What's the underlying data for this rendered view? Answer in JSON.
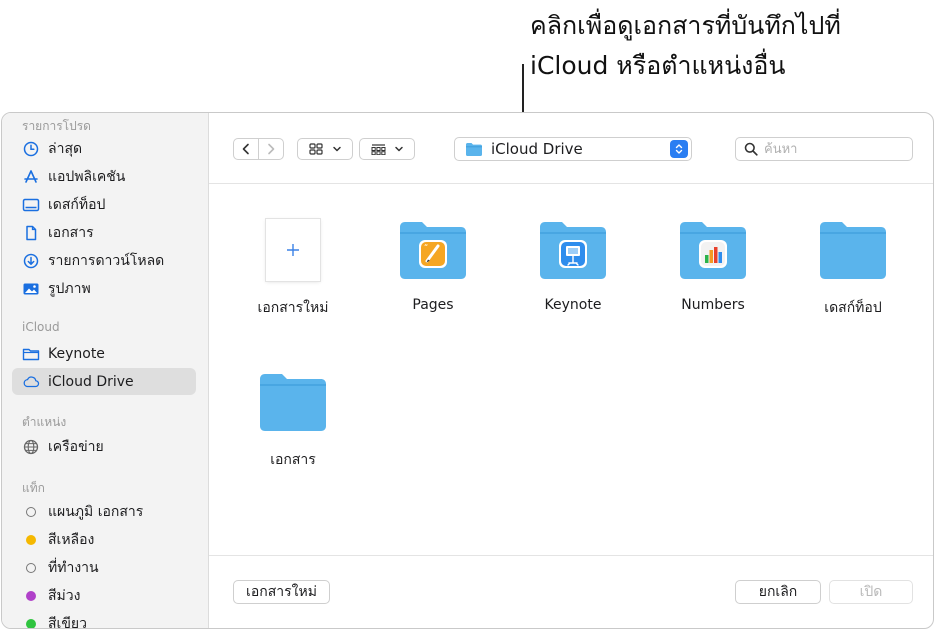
{
  "callout": {
    "line1": "คลิกเพื่อดูเอกสารที่บันทึกไปที่",
    "line2": "iCloud หรือตำแหน่งอื่น"
  },
  "sidebar": {
    "favorites_header": "รายการโปรด",
    "favorites": [
      {
        "label": "ล่าสุด",
        "icon": "clock-icon"
      },
      {
        "label": "แอปพลิเคชัน",
        "icon": "applications-icon"
      },
      {
        "label": "เดสก์ท็อป",
        "icon": "desktop-icon"
      },
      {
        "label": "เอกสาร",
        "icon": "document-icon"
      },
      {
        "label": "รายการดาวน์โหลด",
        "icon": "download-icon"
      },
      {
        "label": "รูปภาพ",
        "icon": "photo-icon"
      }
    ],
    "icloud_header": "iCloud",
    "icloud": [
      {
        "label": "Keynote",
        "icon": "folder-icon"
      },
      {
        "label": "iCloud Drive",
        "icon": "cloud-icon",
        "selected": true
      }
    ],
    "locations_header": "ตำแหน่ง",
    "locations": [
      {
        "label": "เครือข่าย",
        "icon": "globe-icon"
      }
    ],
    "tags_header": "แท็ก",
    "tags": [
      {
        "label": "แผนภูมิ เอกสาร",
        "color": ""
      },
      {
        "label": "สีเหลือง",
        "color": "#f5b800"
      },
      {
        "label": "ที่ทำงาน",
        "color": ""
      },
      {
        "label": "สีม่วง",
        "color": "#b041c9"
      },
      {
        "label": "สีเขียว",
        "color": "#2fc43f"
      }
    ]
  },
  "toolbar": {
    "location": "iCloud Drive",
    "search_placeholder": "ค้นหา"
  },
  "files": [
    {
      "label": "เอกสารใหม่",
      "type": "new-document"
    },
    {
      "label": "Pages",
      "type": "pages-folder"
    },
    {
      "label": "Keynote",
      "type": "keynote-folder"
    },
    {
      "label": "Numbers",
      "type": "numbers-folder"
    },
    {
      "label": "เดสก์ท็อป",
      "type": "folder"
    },
    {
      "label": "เอกสาร",
      "type": "folder"
    }
  ],
  "footer": {
    "new_document": "เอกสารใหม่",
    "cancel": "ยกเลิก",
    "open": "เปิด"
  },
  "colors": {
    "accent": "#2a7ef2",
    "folder": "#5ab4ec",
    "sidebar_icon": "#1a6fe0"
  }
}
